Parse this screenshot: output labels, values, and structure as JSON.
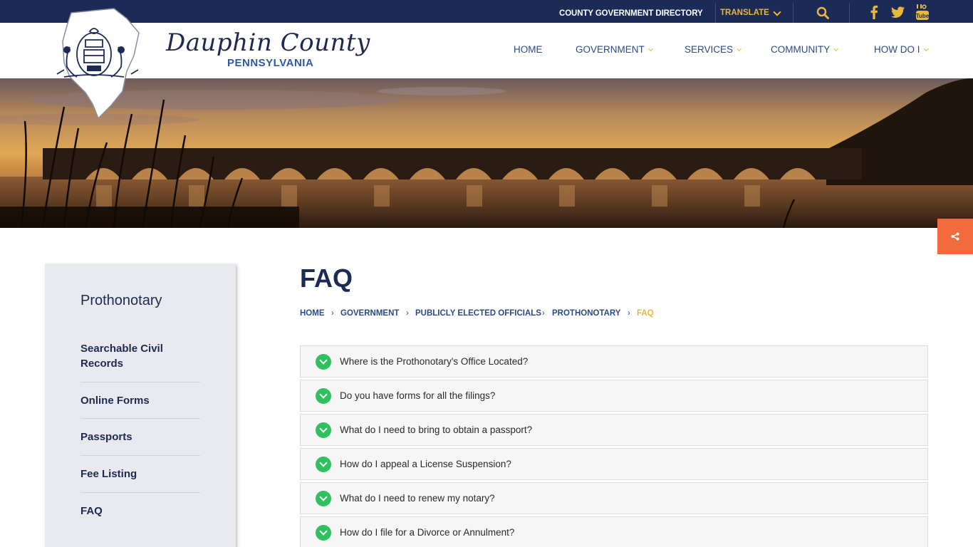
{
  "topbar": {
    "directory_label": "COUNTY GOVERNMENT DIRECTORY",
    "translate_label": "TRANSLATE",
    "icons": [
      "search-icon",
      "facebook-icon",
      "twitter-icon",
      "youtube-icon"
    ]
  },
  "brand": {
    "name": "Dauphin County",
    "state": "PENNSYLVANIA"
  },
  "nav": {
    "items": [
      {
        "label": "HOME",
        "has_dropdown": false
      },
      {
        "label": "GOVERNMENT",
        "has_dropdown": true
      },
      {
        "label": "SERVICES",
        "has_dropdown": true
      },
      {
        "label": "COMMUNITY",
        "has_dropdown": true
      },
      {
        "label": "HOW DO I",
        "has_dropdown": true
      }
    ]
  },
  "sidebar": {
    "title": "Prothonotary",
    "links": [
      "Searchable Civil Records",
      "Online Forms",
      "Passports",
      "Fee Listing",
      "FAQ"
    ]
  },
  "main": {
    "title": "FAQ",
    "breadcrumb": [
      "HOME",
      "GOVERNMENT",
      "PUBLICLY ELECTED OFFICIALS",
      "PROTHONOTARY",
      "FAQ"
    ],
    "faqs": [
      "Where is the Prothonotary's Office Located?",
      "Do you have forms for all the filings?",
      "What do I need to bring to obtain a passport?",
      "How do I appeal a License Suspension?",
      "What do I need to renew my notary?",
      "How do I file for a Divorce or Annulment?"
    ]
  },
  "colors": {
    "navy": "#1c2a57",
    "accent_gold": "#e8b83a",
    "share_orange": "#f26a3d",
    "faq_icon_green": "#2ec25e"
  }
}
